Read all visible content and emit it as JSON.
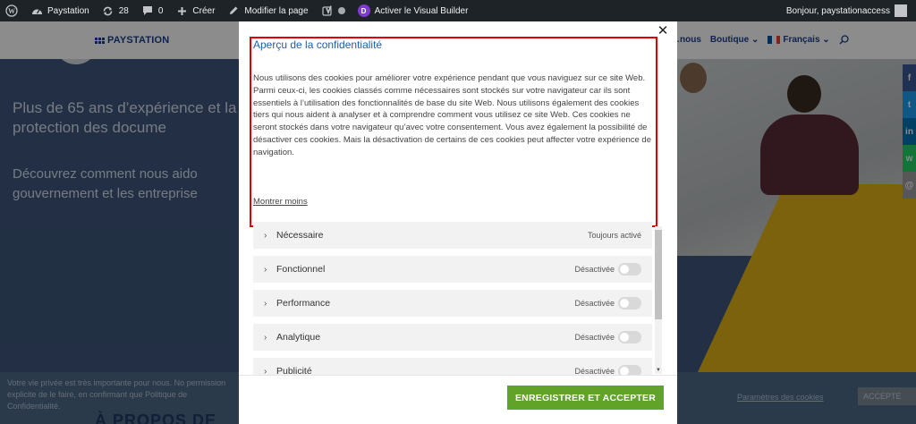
{
  "adminbar": {
    "site_name": "Paystation",
    "updates_count": "28",
    "comments_count": "0",
    "create_label": "Créer",
    "edit_label": "Modifier la page",
    "visual_builder_label": "Activer le Visual Builder",
    "greeting": "Bonjour, paystationaccess"
  },
  "header": {
    "logo_text": "PAYSTATION",
    "nav": [
      {
        "label": "…nous"
      },
      {
        "label": "Boutique ⌄"
      },
      {
        "label": "Français ⌄"
      }
    ]
  },
  "hero": {
    "headline": "Plus de 65 ans d’expérience et la protection des docume",
    "subline": "Découvrez comment nous aido gouvernement et les entreprise"
  },
  "cookie_notice": {
    "text": "Votre vie privée est très importante pour nous. No permission explicite de le faire, en confirmant que Politique de Confidentialité.",
    "settings_link": "Paramètres des cookies",
    "accept_label": "ACCEPTE"
  },
  "about": {
    "title": "À PROPOS DE"
  },
  "modal": {
    "title": "Aperçu de la confidentialité",
    "description": "Nous utilisons des cookies pour améliorer votre expérience pendant que vous naviguez sur ce site Web. Parmi ceux-ci, les cookies classés comme nécessaires sont stockés sur votre navigateur car ils sont essentiels à l’utilisation des fonctionnalités de base du site Web. Nous utilisons également des cookies tiers qui nous aident à analyser et à comprendre comment vous utilisez ce site Web. Ces cookies ne seront stockés dans votre navigateur qu’avec votre consentement. Vous avez également la possibilité de désactiver ces cookies. Mais la désactivation de certains de ces cookies peut affecter votre expérience de navigation.",
    "show_less": "Montrer moins",
    "close_symbol": "✕",
    "categories": [
      {
        "name": "Nécessaire",
        "status": "Toujours activé"
      },
      {
        "name": "Fonctionnel",
        "status": "Désactivée"
      },
      {
        "name": "Performance",
        "status": "Désactivée"
      },
      {
        "name": "Analytique",
        "status": "Désactivée"
      },
      {
        "name": "Publicité",
        "status": "Désactivée"
      }
    ],
    "save_button": "ENREGISTRER ET ACCEPTER"
  },
  "colors": {
    "admin_bar": "#1d2327",
    "link_blue": "#1f5ea8",
    "accept_green": "#61a229",
    "highlight_red": "#e00000"
  }
}
